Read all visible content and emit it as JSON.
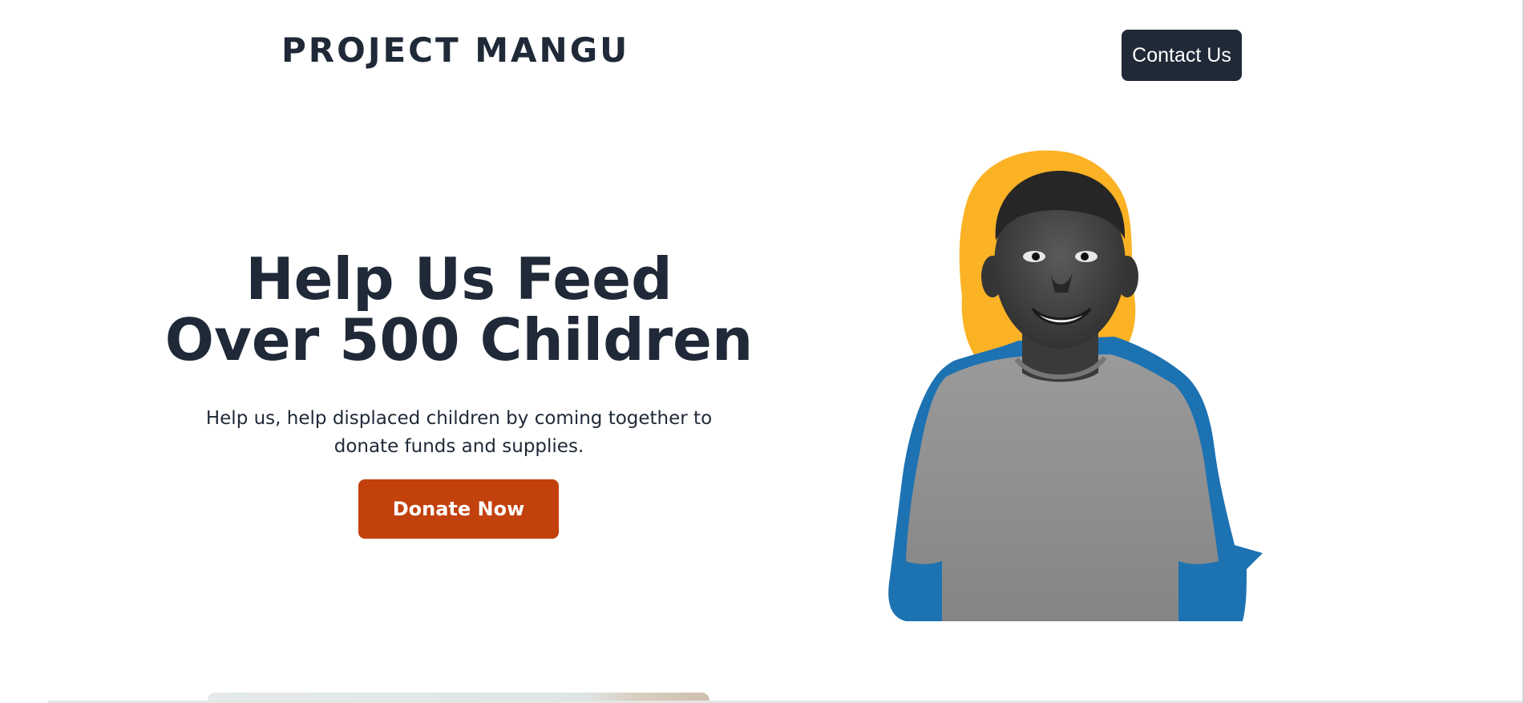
{
  "header": {
    "logo_text": "PROJECT MANGU",
    "contact_label": "Contact Us"
  },
  "hero": {
    "title": "Help Us Feed Over 500 Children",
    "subtitle": "Help us, help displaced children by coming together to donate funds and supplies.",
    "donate_label": "Donate Now"
  },
  "colors": {
    "primary_dark": "#1f2937",
    "donate_orange": "#c2410c",
    "accent_yellow": "#fbb224",
    "accent_blue": "#1d72b2"
  }
}
